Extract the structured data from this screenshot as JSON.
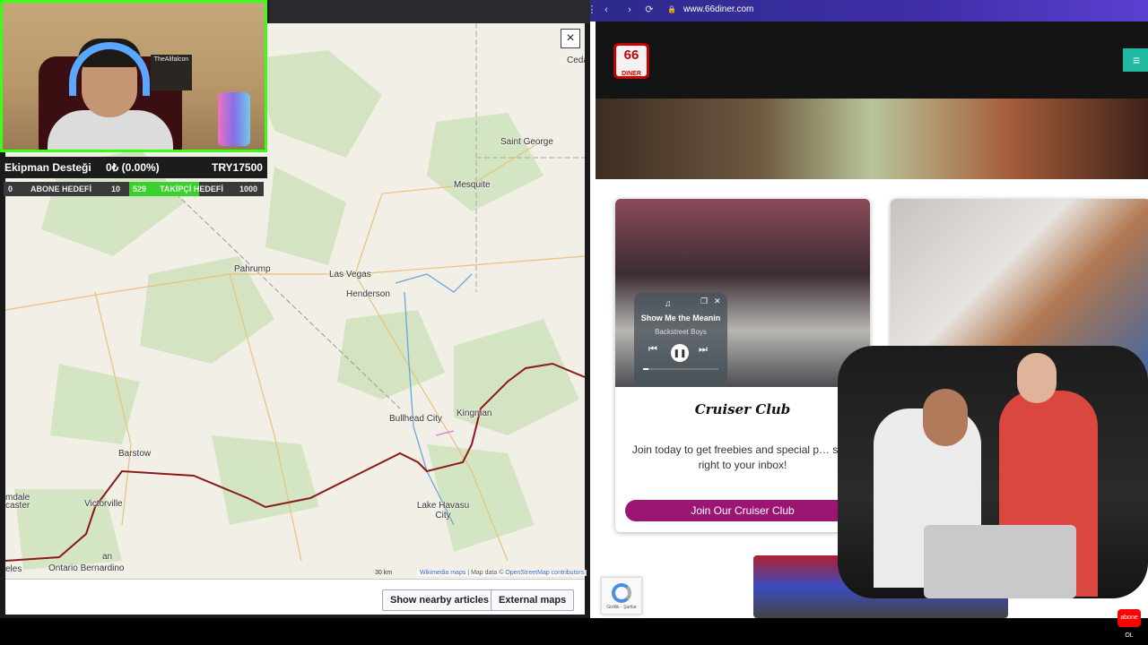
{
  "stream": {
    "donation_label": "Ekipman Desteği",
    "donation_amount": "0₺ (0.00%)",
    "donation_goal": "TRY17500",
    "sub_current": "0",
    "sub_label": "ABONE HEDEFİ",
    "sub_goal": "10",
    "follow_current": "529",
    "follow_label": "TAKİPÇİ HEDEFİ",
    "follow_goal": "1000",
    "follow_progress": 0.529,
    "poster_text": "TheAlifalcon"
  },
  "map": {
    "close_label": "×",
    "places": [
      "Ceda",
      "Saint George",
      "Mesquite",
      "Pahrump",
      "Las Vegas",
      "Henderson",
      "Bullhead City",
      "Kingman",
      "Barstow",
      "Victorville",
      "Lake Havasu City",
      "caster",
      "mdale",
      "Ontario Bernardino",
      "eles",
      "an"
    ],
    "scale": "30 km",
    "attribution_link1": "Wikimedia maps",
    "attribution_sep": " | Map data © ",
    "attribution_link2": "OpenStreetMap contributors",
    "btn_nearby": "Show nearby articles",
    "btn_external": "External maps"
  },
  "browser": {
    "url": "www.66diner.com",
    "back": "‹",
    "forward": "›",
    "reload": "⟳",
    "lock": "🔒",
    "menu_dots": "⋮",
    "logo_top": "66",
    "logo_bottom": "DINER",
    "menu_icon": "≡"
  },
  "site": {
    "card_title": "Cruiser Club",
    "card_text": "Join today to get freebies and special p… sent right to your inbox!",
    "join_button": "Join Our Cruiser Club",
    "recaptcha_text": "Gizlilik - Şartlar"
  },
  "media": {
    "title": "Show Me the Meanin",
    "artist": "Backstreet Boys",
    "prev": "⏮",
    "pause": "❚❚",
    "next": "⏭",
    "expand": "❐",
    "close": "✕"
  },
  "yt": {
    "label": "abone OL"
  },
  "colors": {
    "stream_border": "#39ff14",
    "join": "#9b1673",
    "route": "#8b1a1a",
    "teal": "#1fb8a0"
  }
}
